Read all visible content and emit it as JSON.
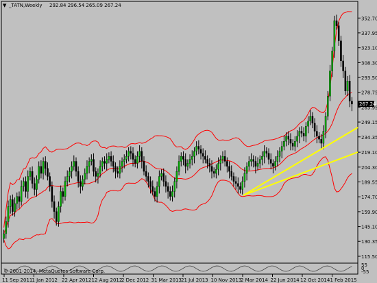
{
  "chart_header": {
    "symbol": "_TATN,Weekly",
    "ohlc": "292.84 296.54 265.09 267.24",
    "marker": "▼"
  },
  "footer_text": "© 2001-2014, MetaQuotes Software Corp.",
  "current_price_label": "267.24",
  "colors": {
    "background": "#c0c0c0",
    "up_candle": "#00aa00",
    "down_candle": "#000000",
    "bollinger": "#ff0000",
    "trendline": "#ffff00"
  },
  "chart_data": {
    "type": "candlestick",
    "title": "_TATN,Weekly",
    "y_ticks": [
      "352.70",
      "337.95",
      "323.10",
      "308.30",
      "293.50",
      "278.75",
      "263.95",
      "249.15",
      "234.35",
      "219.10",
      "204.30",
      "189.55",
      "174.70",
      "159.90",
      "145.10",
      "130.35",
      "115.50"
    ],
    "x_ticks": [
      "11 Sep 2011",
      "1 Jan 2012",
      "22 Apr 2012",
      "12 Aug 2012",
      "2 Dec 2012",
      "31 Mar 2013",
      "21 Jul 2013",
      "10 Nov 2013",
      "2 Mar 2014",
      "22 Jun 2014",
      "12 Oct 2014",
      "1 Feb 2015"
    ],
    "y_range": [
      115.5,
      357
    ],
    "indicator_ticks": [
      "55",
      "0",
      "-55"
    ],
    "closes": [
      138,
      150,
      165,
      172,
      160,
      168,
      175,
      170,
      185,
      190,
      180,
      195,
      200,
      188,
      182,
      192,
      205,
      198,
      210,
      203,
      195,
      185,
      170,
      160,
      150,
      165,
      180,
      175,
      190,
      195,
      200,
      205,
      210,
      200,
      190,
      185,
      192,
      198,
      205,
      210,
      212,
      200,
      195,
      198,
      205,
      210,
      208,
      212,
      215,
      210,
      205,
      200,
      198,
      205,
      210,
      212,
      215,
      220,
      218,
      212,
      208,
      215,
      220,
      210,
      200,
      195,
      190,
      185,
      180,
      175,
      185,
      195,
      198,
      190,
      185,
      180,
      175,
      180,
      190,
      200,
      210,
      215,
      212,
      205,
      208,
      212,
      215,
      220,
      225,
      222,
      218,
      215,
      212,
      208,
      205,
      200,
      198,
      202,
      208,
      212,
      215,
      210,
      205,
      200,
      195,
      190,
      188,
      185,
      182,
      190,
      198,
      205,
      210,
      212,
      210,
      205,
      208,
      212,
      215,
      220,
      218,
      212,
      208,
      205,
      210,
      215,
      220,
      225,
      230,
      235,
      232,
      228,
      225,
      230,
      235,
      240,
      238,
      235,
      245,
      250,
      255,
      248,
      240,
      235,
      232,
      228,
      240,
      255,
      275,
      300,
      320,
      350,
      345,
      330,
      310,
      300,
      280,
      290,
      270,
      267
    ]
  }
}
